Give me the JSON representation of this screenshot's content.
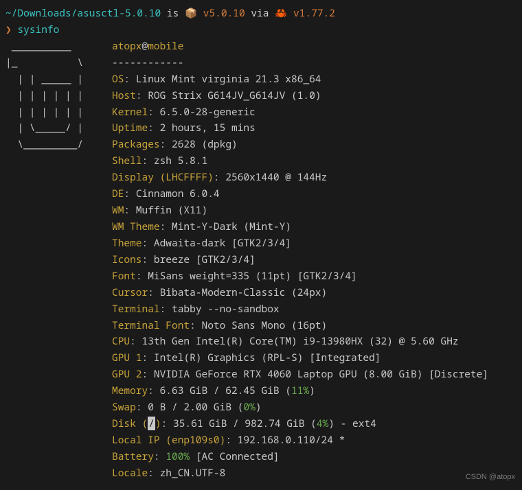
{
  "prompt": {
    "path": "~/Downloads/asusctl-5.0.10",
    "is_word": "is",
    "box_icon": "📦",
    "version1": "v5.0.10",
    "via_word": "via",
    "crab_icon": "🦀",
    "version2": "v1.77.2",
    "arrow": "❯",
    "command": "sysinfo"
  },
  "ascii": {
    "l0": " __________",
    "l1": "|_          \\",
    "l2": "  | | _____ |",
    "l3": "  | | | | | |",
    "l4": "  | | | | | |",
    "l5": "  | \\_____/ |",
    "l6": "  \\_________/"
  },
  "header": {
    "user": "atopx",
    "at": "@",
    "host": "mobile",
    "sep": "------------"
  },
  "info": {
    "os": {
      "label": "OS",
      "value": "Linux Mint virginia 21.3 x86_64"
    },
    "host": {
      "label": "Host",
      "value": "ROG Strix G614JV_G614JV (1.0)"
    },
    "kernel": {
      "label": "Kernel",
      "value": "6.5.0-28-generic"
    },
    "uptime": {
      "label": "Uptime",
      "value": "2 hours, 15 mins"
    },
    "packages": {
      "label": "Packages",
      "value": "2628 (dpkg)"
    },
    "shell": {
      "label": "Shell",
      "value": "zsh 5.8.1"
    },
    "display": {
      "label": "Display (LHCFFFF)",
      "value": "2560x1440 @ 144Hz"
    },
    "de": {
      "label": "DE",
      "value": "Cinnamon 6.0.4"
    },
    "wm": {
      "label": "WM",
      "value": "Muffin (X11)"
    },
    "wmtheme": {
      "label": "WM Theme",
      "value": "Mint-Y-Dark (Mint-Y)"
    },
    "theme": {
      "label": "Theme",
      "value": "Adwaita-dark [GTK2/3/4]"
    },
    "icons": {
      "label": "Icons",
      "value": "breeze [GTK2/3/4]"
    },
    "font": {
      "label": "Font",
      "value": "MiSans weight=335 (11pt) [GTK2/3/4]"
    },
    "cursor": {
      "label": "Cursor",
      "value": "Bibata-Modern-Classic (24px)"
    },
    "terminal": {
      "label": "Terminal",
      "value": "tabby --no-sandbox"
    },
    "terminalfont": {
      "label": "Terminal Font",
      "value": "Noto Sans Mono (16pt)"
    },
    "cpu": {
      "label": "CPU",
      "value": "13th Gen Intel(R) Core(TM) i9-13980HX (32) @ 5.60 GHz"
    },
    "gpu1": {
      "label": "GPU 1",
      "value": "Intel(R) Graphics (RPL-S) [Integrated]"
    },
    "gpu2": {
      "label": "GPU 2",
      "value": "NVIDIA GeForce RTX 4060 Laptop GPU (8.00 GiB) [Discrete]"
    },
    "memory": {
      "label": "Memory",
      "pre": "6.63 GiB / 62.45 GiB (",
      "pct": "11%",
      "post": ")"
    },
    "swap": {
      "label": "Swap",
      "pre": "0 B / 2.00 GiB (",
      "pct": "0%",
      "post": ")"
    },
    "disk": {
      "label_pre": "Disk (",
      "label_mid": "/",
      "label_post": ")",
      "pre": "35.61 GiB / 982.74 GiB (",
      "pct": "4%",
      "post": ") - ext4"
    },
    "localip": {
      "label": "Local IP (enp109s0)",
      "value": "192.168.0.110/24 *"
    },
    "battery": {
      "label": "Battery",
      "pct": "100%",
      "post": " [AC Connected]"
    },
    "locale": {
      "label": "Locale",
      "value": "zh_CN.UTF-8"
    }
  },
  "watermark": "CSDN @atopx"
}
